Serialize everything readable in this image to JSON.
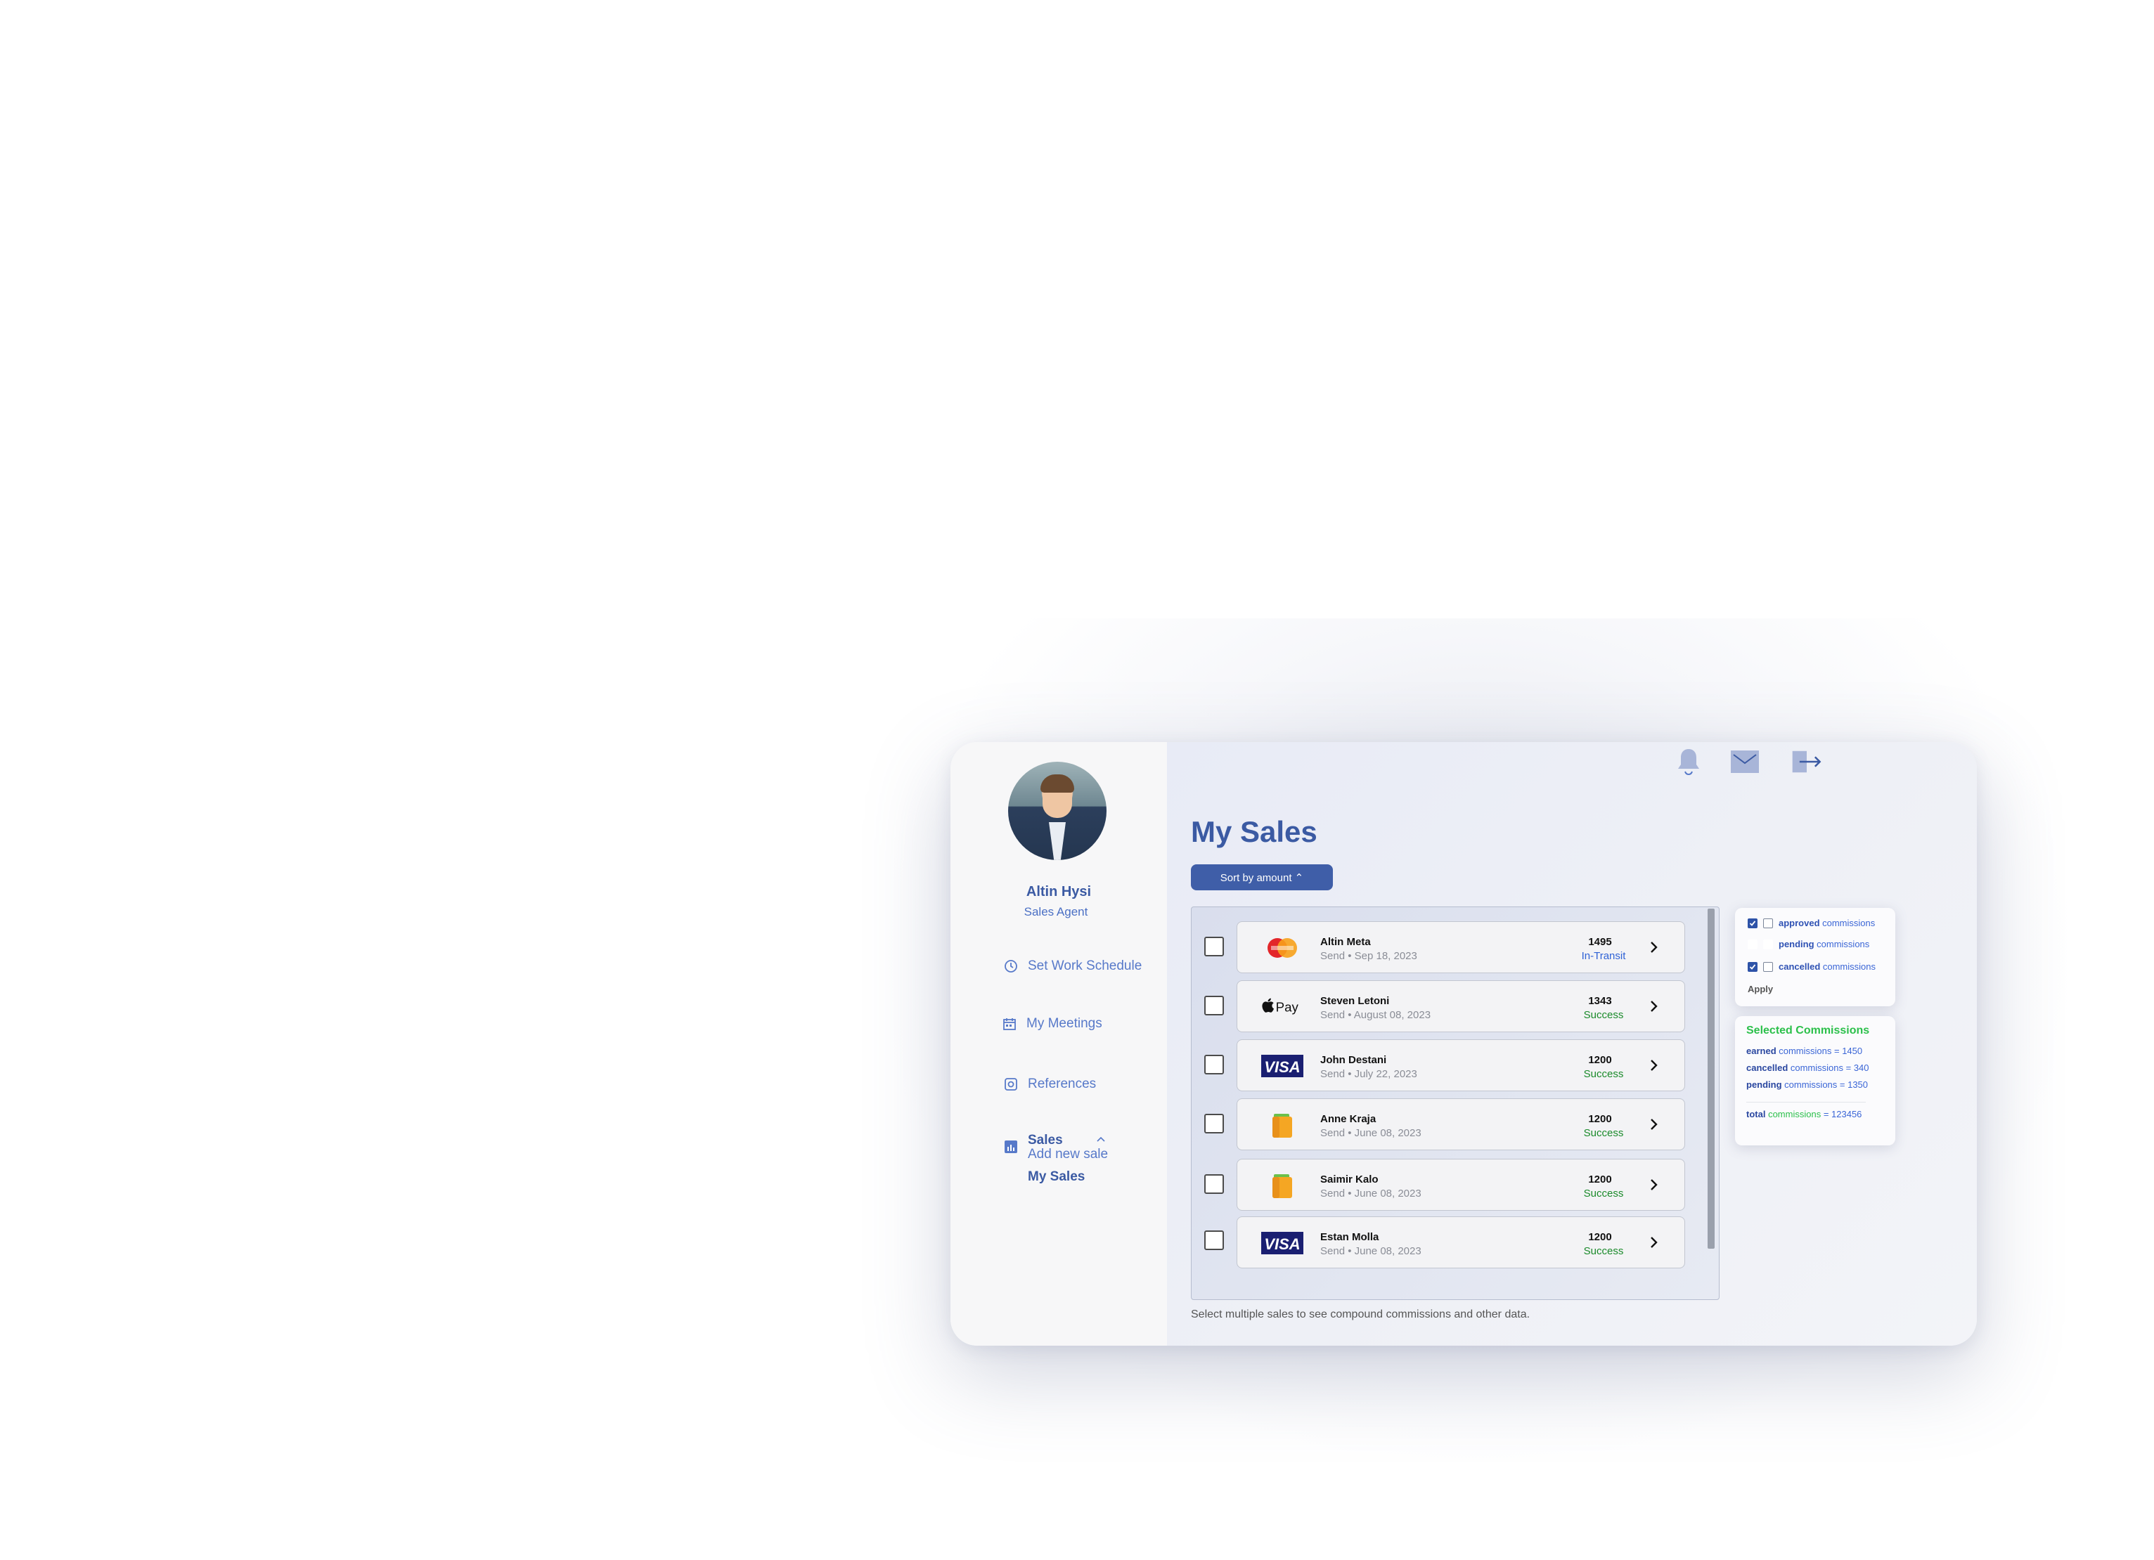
{
  "user": {
    "name": "Altin Hysi",
    "role": "Sales Agent"
  },
  "nav": {
    "items": [
      {
        "label": "Set Work Schedule",
        "icon": "clock-icon"
      },
      {
        "label": "My Meetings",
        "icon": "calendar-icon"
      },
      {
        "label": "References",
        "icon": "reference-icon"
      },
      {
        "label": "Sales",
        "icon": "chart-icon"
      }
    ],
    "sales_submenu": [
      "Add new sale",
      "My Sales"
    ],
    "active": "My Sales"
  },
  "header": {
    "icons": [
      "bell-icon",
      "mail-icon",
      "logout-icon"
    ]
  },
  "page": {
    "title": "My Sales",
    "sort_label": "Sort by amount ⌃",
    "footnote": "Select multiple sales to see compound commissions and other data."
  },
  "sales": [
    {
      "name": "Altin Meta",
      "sub": "Send • Sep 18, 2023",
      "amount": "1495",
      "status": "In-Transit",
      "method": "mastercard"
    },
    {
      "name": "Steven Letoni",
      "sub": "Send • August 08, 2023",
      "amount": "1343",
      "status": "Success",
      "method": "applepay"
    },
    {
      "name": "John Destani",
      "sub": "Send • July 22, 2023",
      "amount": "1200",
      "status": "Success",
      "method": "visa"
    },
    {
      "name": "Anne Kraja",
      "sub": "Send • June 08, 2023",
      "amount": "1200",
      "status": "Success",
      "method": "wallet"
    },
    {
      "name": "Saimir Kalo",
      "sub": "Send • June 08, 2023",
      "amount": "1200",
      "status": "Success",
      "method": "wallet"
    },
    {
      "name": "Estan Molla",
      "sub": "Send • June 08, 2023",
      "amount": "1200",
      "status": "Success",
      "method": "visa"
    }
  ],
  "filters": {
    "items": [
      {
        "key": "approved",
        "rest": " commissions",
        "checked": true
      },
      {
        "key": "pending",
        "rest": " commissions",
        "checked": false
      },
      {
        "key": "cancelled",
        "rest": " commissions",
        "checked": true
      }
    ],
    "apply_label": "Apply"
  },
  "summary": {
    "title": "Selected Commissions",
    "lines": [
      {
        "key": "earned",
        "rest": " commissions = 1450"
      },
      {
        "key": "cancelled",
        "rest": " commissions = 340"
      },
      {
        "key": "pending",
        "rest": " commissions = 1350"
      }
    ],
    "total": {
      "key": "total",
      "mid": " commissions",
      "rest": " = 123456"
    }
  },
  "colors": {
    "accent": "#3b5aa3",
    "success": "#1a8a2a",
    "transit": "#2f62d6",
    "summary_title": "#2cc04b"
  }
}
